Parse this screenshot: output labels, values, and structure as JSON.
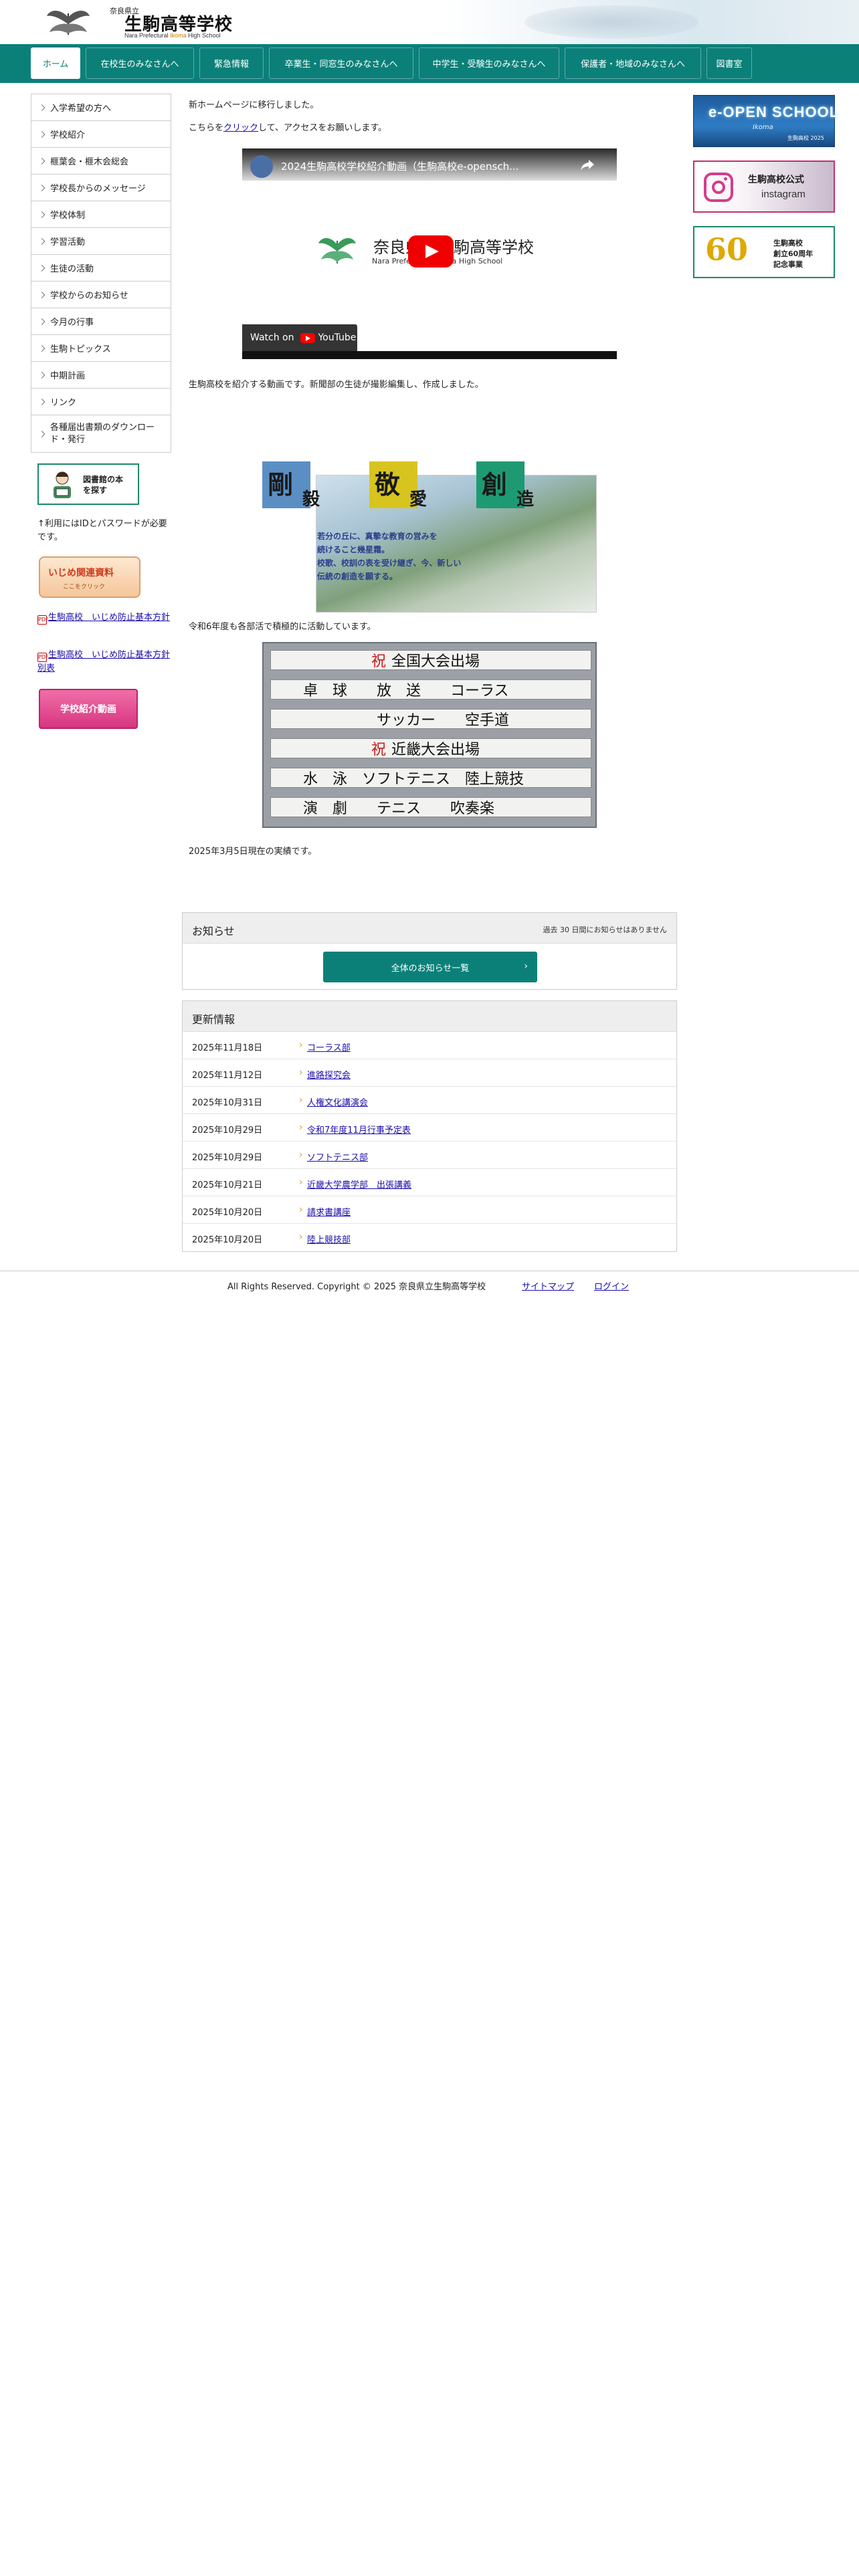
{
  "header": {
    "logo_prefecture": "奈良県立",
    "logo_name": "生駒高等学校",
    "logo_en_pre": "Nara Prefectural ",
    "logo_en_ikoma": "Ikoma",
    "logo_en_post": " High School"
  },
  "nav": {
    "items": [
      {
        "label": "ホーム",
        "active": true
      },
      {
        "label": "在校生のみなさんへ"
      },
      {
        "label": "緊急情報"
      },
      {
        "label": "卒業生・同窓生のみなさんへ"
      },
      {
        "label": "中学生・受験生のみなさんへ"
      },
      {
        "label": "保護者・地域のみなさんへ"
      },
      {
        "label": "図書室"
      }
    ]
  },
  "sidebar": {
    "items": [
      "入学希望の方へ",
      "学校紹介",
      "榧葉会・榧木会総会",
      "学校長からのメッセージ",
      "学校体制",
      "学習活動",
      "生徒の活動",
      "学校からのお知らせ",
      "今月の行事",
      "生駒トピックス",
      "中期計画",
      "リンク",
      "各種届出書類のダウンロード・発行"
    ],
    "library_button": "図書館の本を探す",
    "library_note": "↑利用にはIDとパスワードが必要です。",
    "ijime_title": "いじめ関連資料",
    "ijime_sub": "ここをクリック",
    "pdf_links": [
      "生駒高校　いじめ防止基本方針",
      "生駒高校　いじめ防止基本方針別表"
    ],
    "video_button": "学校紹介動画"
  },
  "main": {
    "intro_line1": "新ホームページに移行しました。",
    "intro_pre": "こちらを",
    "intro_link": "クリック",
    "intro_post": "して、アクセスをお願いします。",
    "video": {
      "title": "2024生駒高校学校紹介動画（生駒高校e-opensch...",
      "school_name": "奈良県立生駒高等学校",
      "school_en": "Nara Prefectural Ikoma High School",
      "watch_on": "Watch on",
      "youtube": "YouTube"
    },
    "video_caption": "生駒高校を紹介する動画です。新聞部の生徒が撮影編集し、作成しました。",
    "creed": {
      "k1": "剛",
      "k1b": "毅",
      "k2": "敬",
      "k2b": "愛",
      "k3": "創",
      "k3b": "造",
      "colors": [
        "#5b8fc4",
        "#d8c41e",
        "#1e9a72"
      ],
      "lines": [
        "若分の丘に、真摯な教育の営みを",
        "続けること幾星霜。",
        "校歌、校訓の表を受け継ぎ、今、新しい",
        "伝統の創造を願する。"
      ]
    },
    "activity_text": "令和6年度も各部活で積極的に活動しています。",
    "board": {
      "rows": [
        {
          "iw": "祝",
          "text": "全国大会出場"
        },
        {
          "iw": "",
          "text": "卓　球　　放　送　　コーラス"
        },
        {
          "iw": "",
          "text": "　　　　　サッカー　　空手道"
        },
        {
          "iw": "祝",
          "text": "近畿大会出場"
        },
        {
          "iw": "",
          "text": "水　泳　ソフトテニス　陸上競技"
        },
        {
          "iw": "",
          "text": "演　劇　　テニス　　吹奏楽"
        }
      ]
    },
    "record_date": "2025年3月5日現在の実績です。"
  },
  "notice": {
    "title": "お知らせ",
    "sub": "過去 30 日間にお知らせはありません",
    "button": "全体のお知らせ一覧",
    "chevron": "›"
  },
  "updates": {
    "title": "更新情報",
    "rows": [
      {
        "date": "2025年11月18日",
        "label": "コーラス部"
      },
      {
        "date": "2025年11月12日",
        "label": "進路探究会"
      },
      {
        "date": "2025年10月31日",
        "label": "人権文化講演会"
      },
      {
        "date": "2025年10月29日",
        "label": "令和7年度11月行事予定表"
      },
      {
        "date": "2025年10月29日",
        "label": "ソフトテニス部"
      },
      {
        "date": "2025年10月21日",
        "label": "近畿大学農学部　出張講義"
      },
      {
        "date": "2025年10月20日",
        "label": "請求書講座"
      },
      {
        "date": "2025年10月20日",
        "label": "陸上競技部"
      }
    ]
  },
  "banners": {
    "open_title": "e-OPEN SCHOOL",
    "open_sub": "Ikoma",
    "open_date": "生駒高校 2025",
    "insta_title": "生駒高校公式",
    "insta_sub": "instagram",
    "sixty_num": "60",
    "sixty_text": [
      "生駒高校",
      "創立60周年",
      "記念事業"
    ]
  },
  "footer": {
    "copyright": "All Rights Reserved. Copyright © 2025 奈良県立生駒高等学校",
    "sitemap": "サイトマップ",
    "login": "ログイン"
  },
  "colors": {
    "brand": "#0b8079",
    "link": "#1a0dab"
  }
}
